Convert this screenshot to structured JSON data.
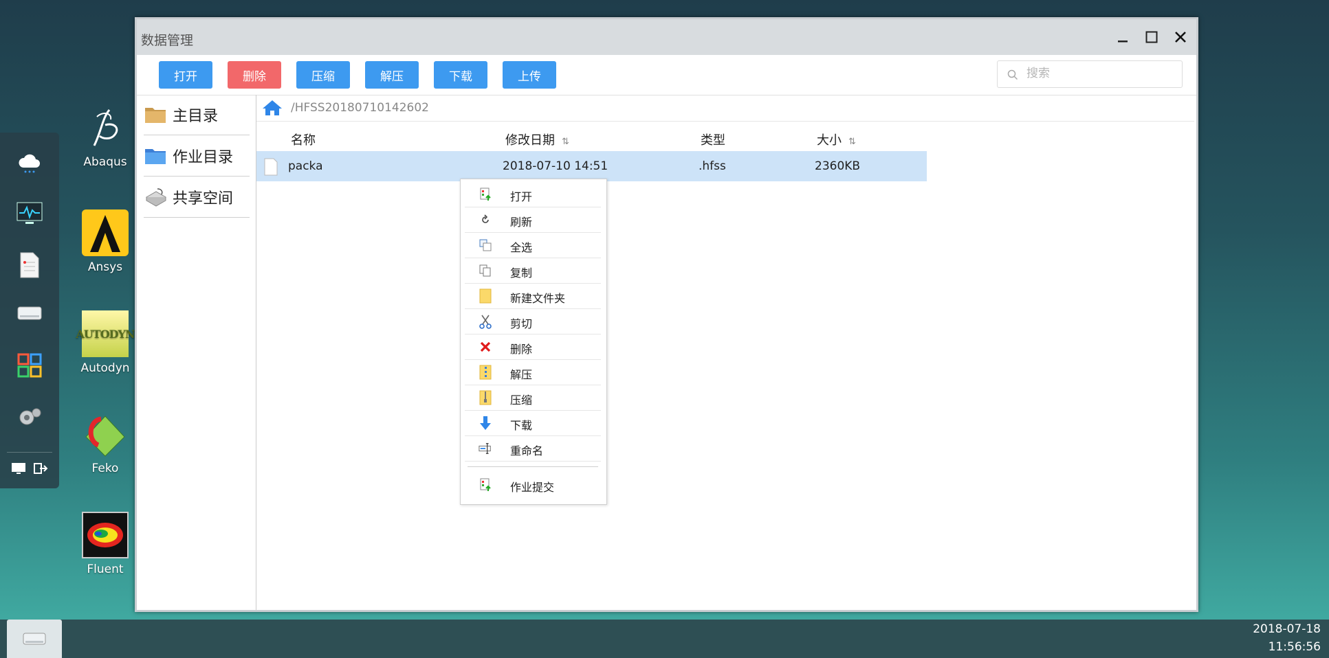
{
  "dock": {
    "items": [
      "cloud-apps-icon",
      "monitor-icon",
      "document-icon",
      "drive-icon",
      "apps-grid-icon",
      "settings-icon"
    ],
    "bottom": [
      "screen-icon",
      "logout-icon"
    ]
  },
  "desktop": {
    "icons": [
      {
        "label": "Abaqus"
      },
      {
        "label": "Ansys"
      },
      {
        "label": "Autodyn",
        "pic_text": "AUTODYN"
      },
      {
        "label": "Feko"
      },
      {
        "label": "Fluent"
      }
    ]
  },
  "window": {
    "title": "数据管理",
    "controls": {
      "minimize": "—",
      "maximize": "☐",
      "close": "✕"
    }
  },
  "toolbar": {
    "open": "打开",
    "delete": "删除",
    "compress": "压缩",
    "extract": "解压",
    "download": "下载",
    "upload": "上传",
    "search_placeholder": "搜索"
  },
  "sidebar": {
    "items": [
      {
        "label": "主目录"
      },
      {
        "label": "作业目录"
      },
      {
        "label": "共享空间"
      }
    ]
  },
  "content": {
    "path": "/HFSS20180710142602",
    "columns": {
      "name": "名称",
      "modified": "修改日期",
      "type": "类型",
      "size": "大小"
    },
    "rows": [
      {
        "name": "packa",
        "modified": "2018-07-10 14:51",
        "type": ".hfss",
        "size": "2360KB"
      }
    ]
  },
  "context_menu": {
    "items": [
      {
        "label": "打开",
        "icon": "open-icon"
      },
      {
        "label": "刷新",
        "icon": "refresh-icon"
      },
      {
        "label": "全选",
        "icon": "select-all-icon"
      },
      {
        "label": "复制",
        "icon": "copy-icon"
      },
      {
        "label": "新建文件夹",
        "icon": "new-folder-icon"
      },
      {
        "label": "剪切",
        "icon": "cut-icon"
      },
      {
        "label": "删除",
        "icon": "delete-icon"
      },
      {
        "label": "解压",
        "icon": "extract-icon"
      },
      {
        "label": "压缩",
        "icon": "compress-icon"
      },
      {
        "label": "下载",
        "icon": "download-icon"
      },
      {
        "label": "重命名",
        "icon": "rename-icon"
      },
      {
        "label": "作业提交",
        "icon": "submit-job-icon"
      }
    ]
  },
  "taskbar": {
    "date": "2018-07-18",
    "time": "11:56:56"
  },
  "colors": {
    "primary_button": "#3d9af0",
    "danger_button": "#f2686a",
    "selected_row": "#cde3f8"
  }
}
